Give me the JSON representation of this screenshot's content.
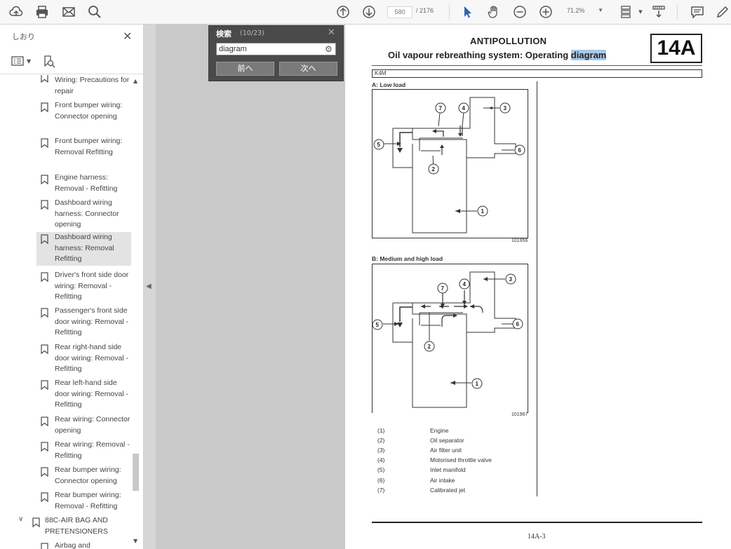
{
  "toolbar": {
    "current_page": "580",
    "total_pages": "/ 2176",
    "zoom": "71.2%"
  },
  "sidebar": {
    "title": "しおり",
    "items": [
      {
        "label": "Wiring: Precautions for repair"
      },
      {
        "label": "Front bumper wiring: Connector opening"
      },
      {
        "label": "Front bumper wiring: Removal Refitting"
      },
      {
        "label": "Engine harness: Removal - Refitting"
      },
      {
        "label": "Dashboard wiring harness: Connector opening"
      },
      {
        "label": "Dashboard wiring harness: Removal Refitting"
      },
      {
        "label": "Driver's front side door wiring: Removal - Refitting"
      },
      {
        "label": "Passenger's front side door wiring: Removal - Refitting"
      },
      {
        "label": "Rear right-hand side door wiring: Removal - Refitting"
      },
      {
        "label": "Rear left-hand side door wiring: Removal - Refitting"
      },
      {
        "label": "Rear wiring: Connector opening"
      },
      {
        "label": "Rear wiring: Removal - Refitting"
      },
      {
        "label": "Rear bumper wiring: Connector opening"
      },
      {
        "label": "Rear bumper wiring: Removal - Refitting"
      }
    ],
    "parent_item": "88C-AIR BAG AND PRETENSIONERS",
    "next_item": "Airbag and"
  },
  "search": {
    "title": "検索",
    "count": "(10/23)",
    "query": "diagram",
    "prev_label": "前へ",
    "next_label": "次へ"
  },
  "page": {
    "heading1": "ANTIPOLLUTION",
    "heading2_pre": "Oil vapour rebreathing system: Operating ",
    "heading2_hl": "diagram",
    "section": "14A",
    "engine": "K4M",
    "diagram_a_label": "A: Low load",
    "diagram_a_ref": "101956",
    "diagram_b_label": "B: Medium and high load",
    "diagram_b_ref": "101967",
    "legend": [
      {
        "num": "(1)",
        "text": "Engine"
      },
      {
        "num": "(2)",
        "text": "Oil separator"
      },
      {
        "num": "(3)",
        "text": "Air filter unit"
      },
      {
        "num": "(4)",
        "text": "Motorised throttle valve"
      },
      {
        "num": "(5)",
        "text": "Inlet manifold"
      },
      {
        "num": "(6)",
        "text": "Air intake"
      },
      {
        "num": "(7)",
        "text": "Calibrated jet"
      }
    ],
    "page_number": "14A-3",
    "callouts": [
      "1",
      "2",
      "3",
      "4",
      "5",
      "6",
      "7"
    ]
  }
}
